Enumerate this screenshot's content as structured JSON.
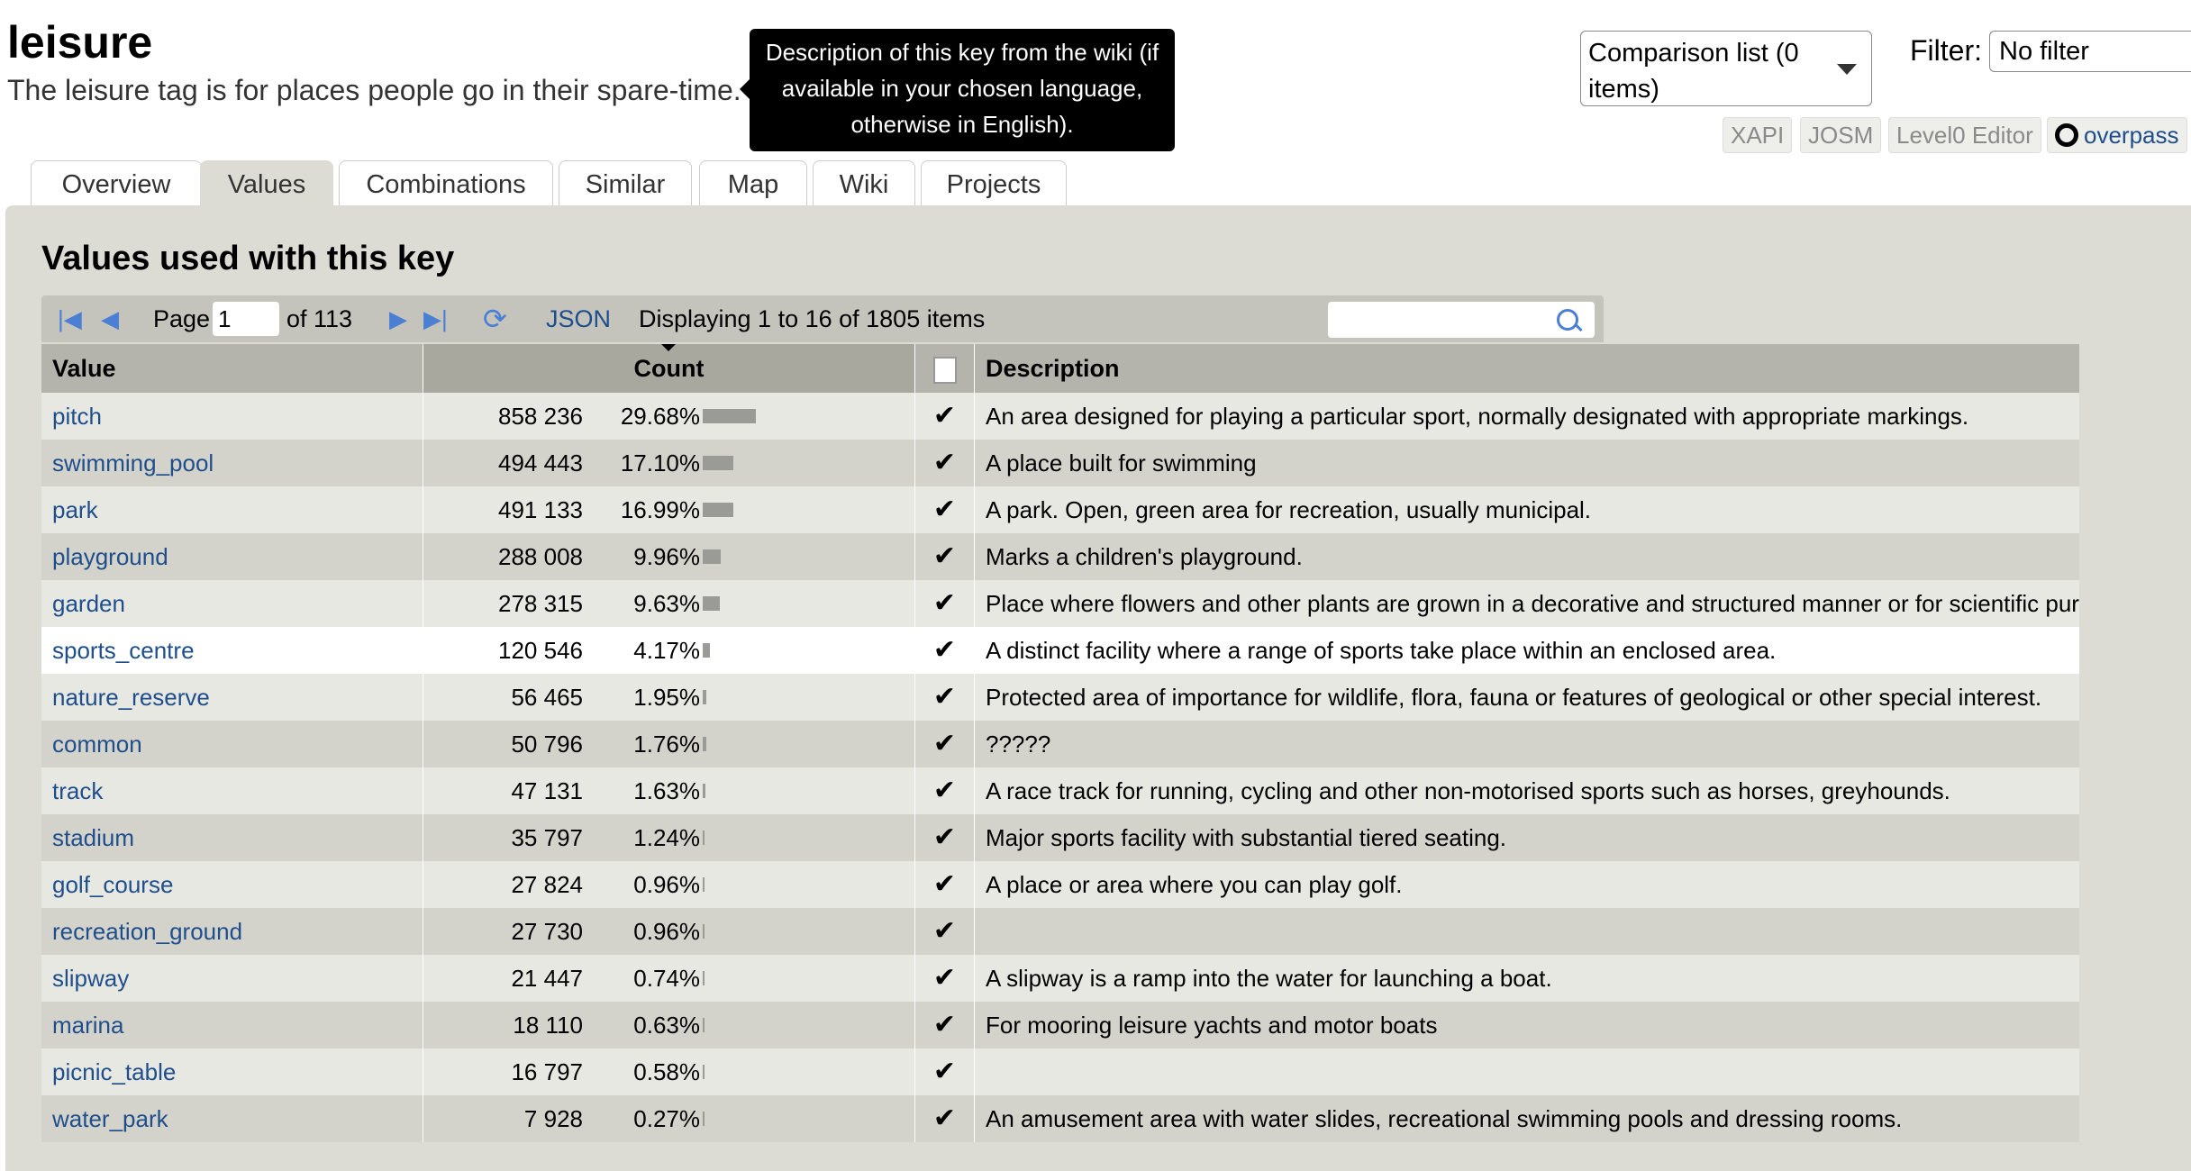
{
  "header": {
    "key": "leisure",
    "description": "The leisure tag is for places people go in their spare-time.",
    "tooltip": "Description of this key from the wiki (if available in your chosen language, otherwise in English).",
    "comparison_list": "Comparison list (0 items)",
    "filter_label": "Filter:",
    "filter_value": "No filter",
    "buttons": {
      "xapi": "XAPI",
      "josm": "JOSM",
      "level0": "Level0 Editor",
      "overpass": "overpass"
    }
  },
  "tabs": [
    "Overview",
    "Values",
    "Combinations",
    "Similar",
    "Map",
    "Wiki",
    "Projects"
  ],
  "active_tab": "Values",
  "section_title": "Values used with this key",
  "pager": {
    "page_label": "Page",
    "page_value": "1",
    "of_label": "of 113",
    "json_label": "JSON",
    "display": "Displaying 1 to 16 of 1805 items"
  },
  "table": {
    "headers": {
      "value": "Value",
      "count": "Count",
      "description": "Description"
    },
    "rows": [
      {
        "value": "pitch",
        "count": "858 236",
        "percent": "29.68%",
        "fraction": 0.2968,
        "check": "✔",
        "description": "An area designed for playing a particular sport, normally designated with appropriate markings."
      },
      {
        "value": "swimming_pool",
        "count": "494 443",
        "percent": "17.10%",
        "fraction": 0.171,
        "check": "✔",
        "description": "A place built for swimming"
      },
      {
        "value": "park",
        "count": "491 133",
        "percent": "16.99%",
        "fraction": 0.1699,
        "check": "✔",
        "description": "A park. Open, green area for recreation, usually municipal."
      },
      {
        "value": "playground",
        "count": "288 008",
        "percent": "9.96%",
        "fraction": 0.0996,
        "check": "✔",
        "description": "Marks a children's playground."
      },
      {
        "value": "garden",
        "count": "278 315",
        "percent": "9.63%",
        "fraction": 0.0963,
        "check": "✔",
        "description": "Place where flowers and other plants are grown in a decorative and structured manner or for scientific purpo"
      },
      {
        "value": "sports_centre",
        "count": "120 546",
        "percent": "4.17%",
        "fraction": 0.0417,
        "check": "✔",
        "description": "A distinct facility where a range of sports take place within an enclosed area."
      },
      {
        "value": "nature_reserve",
        "count": "56 465",
        "percent": "1.95%",
        "fraction": 0.0195,
        "check": "✔",
        "description": "Protected area of importance for wildlife, flora, fauna or features of geological or other special interest."
      },
      {
        "value": "common",
        "count": "50 796",
        "percent": "1.76%",
        "fraction": 0.0176,
        "check": "✔",
        "description": "?????"
      },
      {
        "value": "track",
        "count": "47 131",
        "percent": "1.63%",
        "fraction": 0.0163,
        "check": "✔",
        "description": "A race track for running, cycling and other non-motorised sports such as horses, greyhounds."
      },
      {
        "value": "stadium",
        "count": "35 797",
        "percent": "1.24%",
        "fraction": 0.0124,
        "check": "✔",
        "description": "Major sports facility with substantial tiered seating."
      },
      {
        "value": "golf_course",
        "count": "27 824",
        "percent": "0.96%",
        "fraction": 0.0096,
        "check": "✔",
        "description": "A place or area where you can play golf."
      },
      {
        "value": "recreation_ground",
        "count": "27 730",
        "percent": "0.96%",
        "fraction": 0.0096,
        "check": "✔",
        "description": ""
      },
      {
        "value": "slipway",
        "count": "21 447",
        "percent": "0.74%",
        "fraction": 0.0074,
        "check": "✔",
        "description": "A slipway is a ramp into the water for launching a boat."
      },
      {
        "value": "marina",
        "count": "18 110",
        "percent": "0.63%",
        "fraction": 0.0063,
        "check": "✔",
        "description": "For mooring leisure yachts and motor boats"
      },
      {
        "value": "picnic_table",
        "count": "16 797",
        "percent": "0.58%",
        "fraction": 0.0058,
        "check": "✔",
        "description": ""
      },
      {
        "value": "water_park",
        "count": "7 928",
        "percent": "0.27%",
        "fraction": 0.0027,
        "check": "✔",
        "description": "An amusement area with water slides, recreational swimming pools and dressing rooms."
      }
    ],
    "highlighted_row": "sports_centre"
  }
}
